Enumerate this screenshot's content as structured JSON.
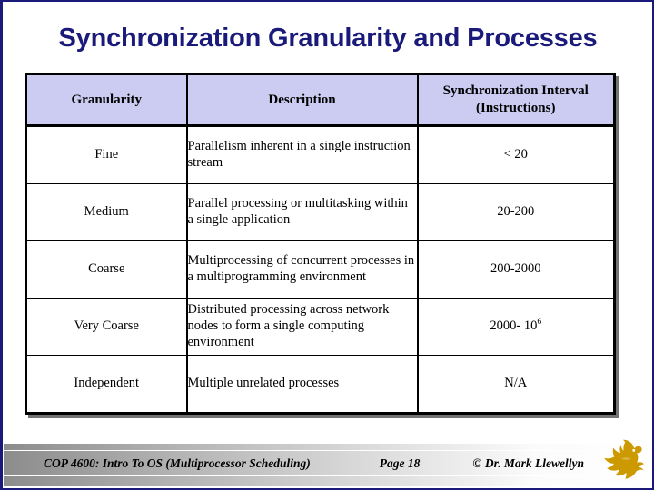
{
  "slide": {
    "title": "Synchronization Granularity and Processes",
    "border_color": "#1a1a7a",
    "title_color": "#1a1a7a"
  },
  "table": {
    "header_bg": "#ccccf2",
    "columns": [
      {
        "label": "Granularity",
        "label_line2": ""
      },
      {
        "label": "Description",
        "label_line2": ""
      },
      {
        "label": "Synchronization Interval",
        "label_line2": "(Instructions)"
      }
    ],
    "rows": [
      {
        "granularity": "Fine",
        "description": "Parallelism inherent in a single instruction stream",
        "interval": "< 20",
        "interval_sup": ""
      },
      {
        "granularity": "Medium",
        "description": "Parallel processing or multitasking within a single application",
        "interval": "20-200",
        "interval_sup": ""
      },
      {
        "granularity": "Coarse",
        "description": "Multiprocessing of concurrent processes in a multiprogramming environment",
        "interval": "200-2000",
        "interval_sup": ""
      },
      {
        "granularity": "Very Coarse",
        "description": "Distributed processing across network nodes to form a single computing environment",
        "interval": "2000- 10",
        "interval_sup": "6"
      },
      {
        "granularity": "Independent",
        "description": "Multiple unrelated processes",
        "interval": "N/A",
        "interval_sup": ""
      }
    ]
  },
  "footer": {
    "course": "COP 4600: Intro To OS  (Multiprocessor Scheduling)",
    "page": "Page 18",
    "credit": "© Dr. Mark Llewellyn",
    "logo_color": "#cc9900"
  }
}
